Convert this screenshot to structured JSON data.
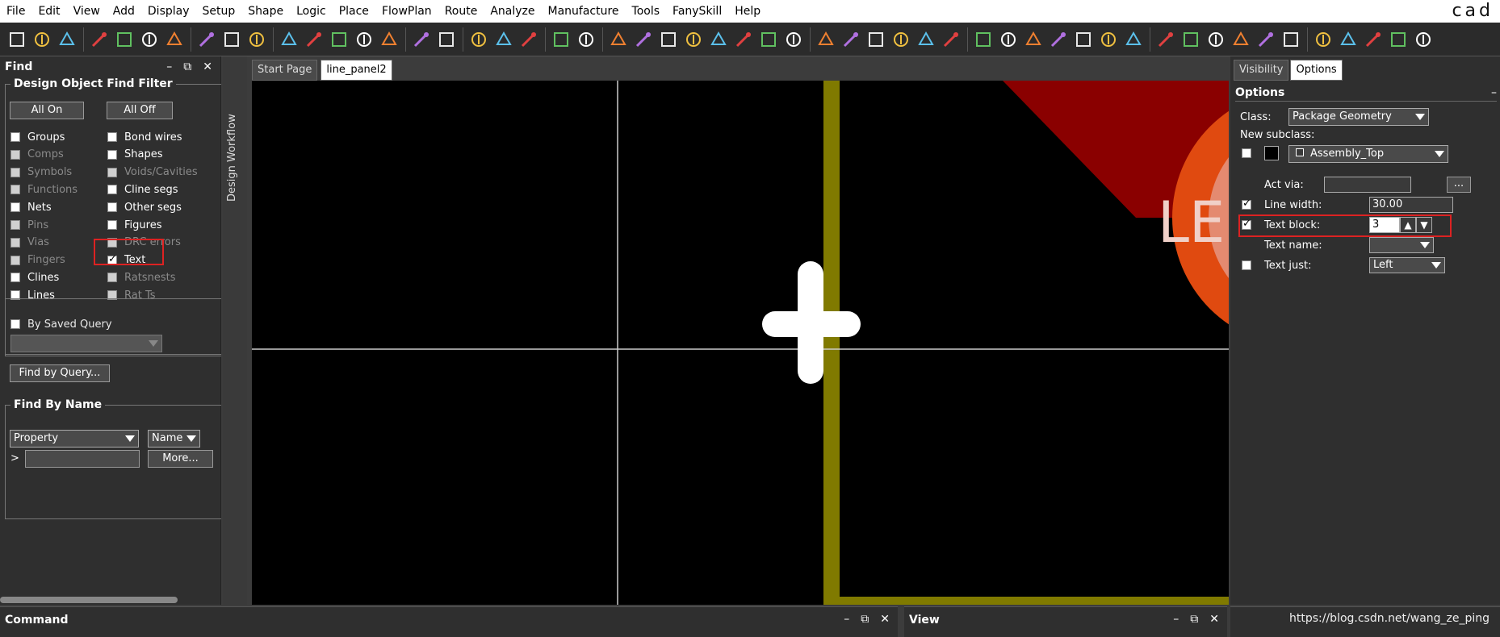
{
  "menu": {
    "items": [
      "File",
      "Edit",
      "View",
      "Add",
      "Display",
      "Setup",
      "Shape",
      "Logic",
      "Place",
      "FlowPlan",
      "Route",
      "Analyze",
      "Manufacture",
      "Tools",
      "FanySkill",
      "Help"
    ],
    "brand": "cad"
  },
  "toolbar": {
    "icons": [
      "new-file-icon",
      "open-folder-icon",
      "open-recent-icon",
      "move-icon",
      "copy-icon",
      "delete-icon",
      "undo-icon",
      "undo-dropdown-icon",
      "redo-icon",
      "redo-dropdown-icon",
      "pin-icon",
      "unpin-icon",
      "add-line-icon",
      "add-text-icon",
      "edit-text-icon",
      "place-component-icon",
      "chip-icon",
      "add-connect-icon",
      "slide-icon",
      "delay-tune-icon",
      "drc-icon",
      "drc-update-icon",
      "zoom-fit-icon",
      "zoom-window-icon",
      "zoom-in-icon",
      "zoom-out-icon",
      "zoom-previous-icon",
      "zoom-world-icon",
      "redraw-icon",
      "3d-view-icon",
      "grid-icon",
      "color-icon",
      "shadow-icon",
      "layers-icon",
      "report-icon",
      "settings-icon",
      "visibility-eye-icon",
      "show-element-icon",
      "measure-icon",
      "highlight-icon",
      "dehighlight-icon",
      "light-icon",
      "dim-icon",
      "shape-add-icon",
      "shape-edit-icon",
      "shape-circle-icon",
      "shape-rect-icon",
      "shape-merge-icon",
      "gloss-icon",
      "padstack-icon",
      "camera-icon",
      "xray-icon",
      "print-icon",
      "transfer-icon"
    ]
  },
  "find": {
    "title": "Find",
    "controls": [
      "–",
      "⧉",
      "✕"
    ],
    "filter_title": "Design Object Find Filter",
    "all_on": "All On",
    "all_off": "All Off",
    "left_col": [
      {
        "label": "Groups",
        "checked": false,
        "enabled": true
      },
      {
        "label": "Comps",
        "checked": false,
        "enabled": false
      },
      {
        "label": "Symbols",
        "checked": false,
        "enabled": false
      },
      {
        "label": "Functions",
        "checked": false,
        "enabled": false
      },
      {
        "label": "Nets",
        "checked": false,
        "enabled": true
      },
      {
        "label": "Pins",
        "checked": false,
        "enabled": false
      },
      {
        "label": "Vias",
        "checked": false,
        "enabled": false
      },
      {
        "label": "Fingers",
        "checked": false,
        "enabled": false
      },
      {
        "label": "Clines",
        "checked": false,
        "enabled": true
      },
      {
        "label": "Lines",
        "checked": false,
        "enabled": true
      }
    ],
    "right_col": [
      {
        "label": "Bond wires",
        "checked": false,
        "enabled": true
      },
      {
        "label": "Shapes",
        "checked": false,
        "enabled": true
      },
      {
        "label": "Voids/Cavities",
        "checked": false,
        "enabled": false
      },
      {
        "label": "Cline segs",
        "checked": false,
        "enabled": true
      },
      {
        "label": "Other segs",
        "checked": false,
        "enabled": true
      },
      {
        "label": "Figures",
        "checked": false,
        "enabled": true
      },
      {
        "label": "DRC errors",
        "checked": false,
        "enabled": false
      },
      {
        "label": "Text",
        "checked": true,
        "enabled": true
      },
      {
        "label": "Ratsnests",
        "checked": false,
        "enabled": false
      },
      {
        "label": "Rat Ts",
        "checked": false,
        "enabled": false
      }
    ],
    "by_saved_query": "By Saved Query",
    "find_by_query": "Find by Query...",
    "find_by_name_title": "Find By Name",
    "property_value": "Property",
    "name_value": "Name",
    "prompt": ">",
    "more": "More..."
  },
  "workflow_tab": "Design Workflow",
  "doc_tabs": [
    "Start Page",
    "line_panel2"
  ],
  "canvas": {
    "label": "LE"
  },
  "options": {
    "tabs": [
      "Visibility",
      "Options"
    ],
    "active_tab": "Options",
    "title": "Options",
    "minimize": "–",
    "class_label": "Class:",
    "class_value": "Package Geometry",
    "new_subclass_label": "New subclass:",
    "subclass_value": "Assembly_Top",
    "act_via_label": "Act via:",
    "act_via_btn": "...",
    "line_width_label": "Line width:",
    "line_width_value": "30.00",
    "text_block_label": "Text block:",
    "text_block_value": "3",
    "text_name_label": "Text name:",
    "text_just_label": "Text just:",
    "text_just_value": "Left"
  },
  "bottom": {
    "command_title": "Command",
    "view_title": "View",
    "controls": [
      "–",
      "⧉",
      "✕"
    ]
  },
  "watermark": "https://blog.csdn.net/wang_ze_ping",
  "colors": {
    "board_outline": "#807a00",
    "pad_orange": "#e04a10",
    "pad_red": "#8a0000"
  }
}
